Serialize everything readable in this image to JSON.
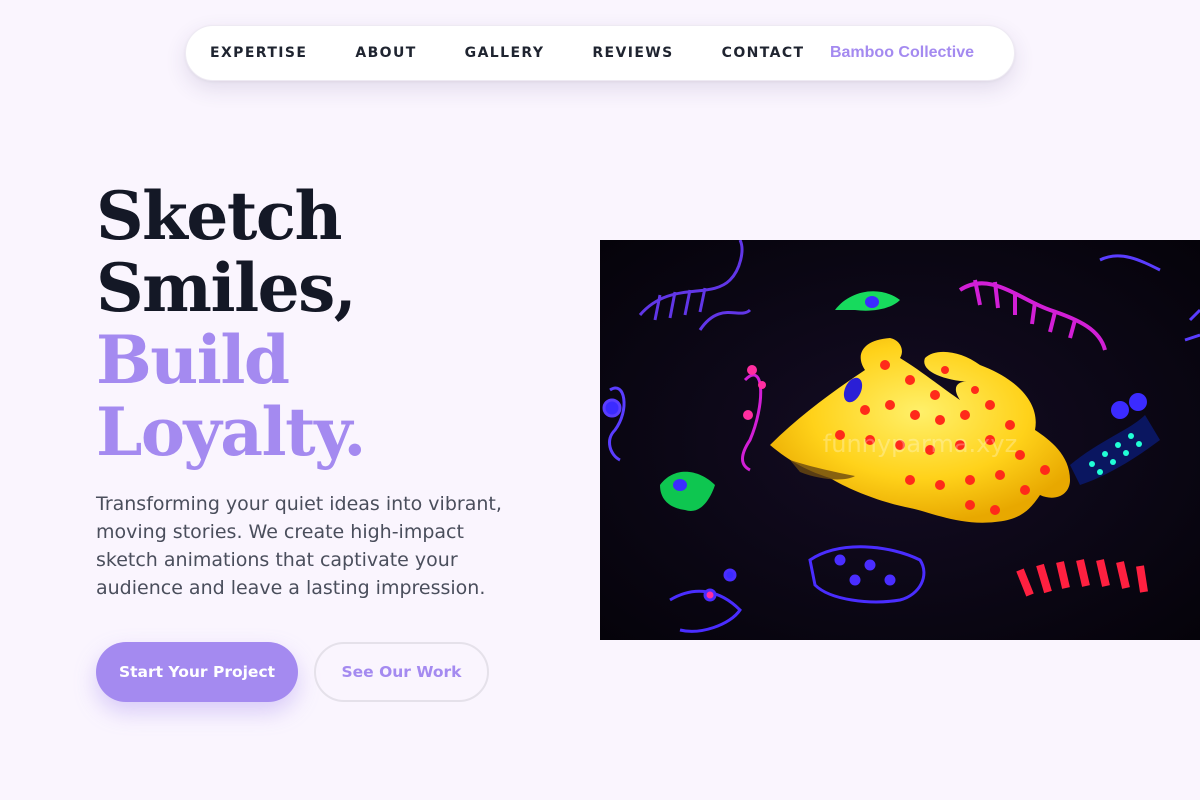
{
  "nav": {
    "links": [
      "EXPERTISE",
      "ABOUT",
      "GALLERY",
      "REVIEWS",
      "CONTACT"
    ],
    "brand": "Bamboo Collective"
  },
  "hero": {
    "title_line1": "Sketch",
    "title_line2": "Smiles,",
    "title_line3": "Build",
    "title_line4": "Loyalty.",
    "description": "Transforming your quiet ideas into vibrant, moving stories. We create high-impact sketch animations that captivate your audience and leave a lasting impression.",
    "primary_cta": "Start Your Project",
    "secondary_cta": "See Our Work",
    "image_watermark": "funnyparma.xyz"
  },
  "colors": {
    "accent": "#a48af0",
    "heading": "#141826",
    "body_text": "#4a4e5c",
    "background": "#faf5fe"
  }
}
